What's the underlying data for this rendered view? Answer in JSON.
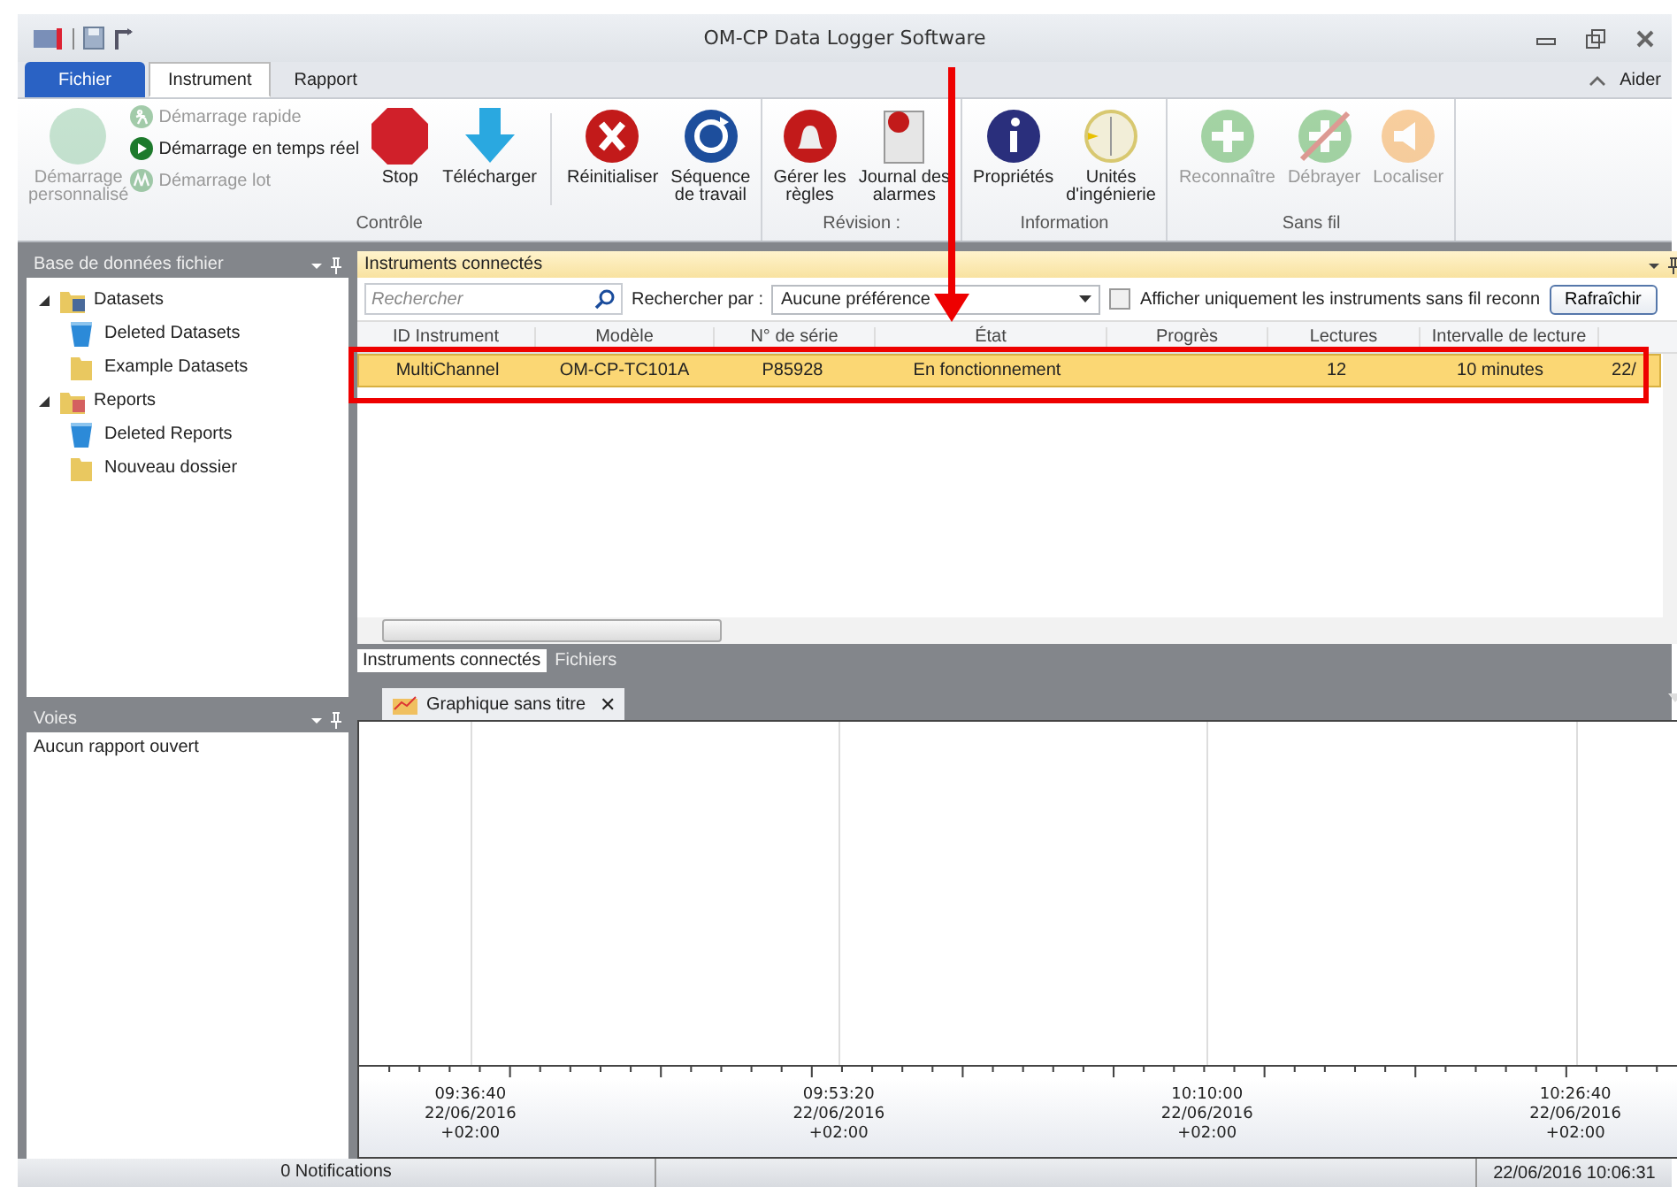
{
  "window": {
    "title": "OM-CP Data Logger Software"
  },
  "ribbon_tabs": [
    {
      "label": "Fichier",
      "kind": "file",
      "selected": false
    },
    {
      "label": "Instrument",
      "kind": "tab",
      "selected": true
    },
    {
      "label": "Rapport",
      "kind": "tab",
      "selected": false
    }
  ],
  "help": "Aider",
  "ribbon_groups": [
    {
      "label": "Contrôle",
      "items": [
        {
          "kind": "large",
          "label": "Démarrage\npersonnalisé",
          "disabled": true
        },
        {
          "kind": "stack",
          "items": [
            {
              "label": "Démarrage rapide",
              "disabled": true
            },
            {
              "label": "Démarrage en temps réel",
              "disabled": false
            },
            {
              "label": "Démarrage lot",
              "disabled": true
            }
          ]
        },
        {
          "kind": "large",
          "label": "Stop",
          "disabled": false
        },
        {
          "kind": "large",
          "label": "Télécharger",
          "disabled": false
        },
        {
          "kind": "separator"
        },
        {
          "kind": "large",
          "label": "Réinitialiser",
          "disabled": false
        },
        {
          "kind": "large",
          "label": "Séquence\nde travail",
          "disabled": false
        }
      ]
    },
    {
      "label": "Révision :",
      "items": [
        {
          "kind": "large",
          "label": "Gérer les\nrègles",
          "disabled": false
        },
        {
          "kind": "large",
          "label": "Journal des\nalarmes",
          "disabled": false
        }
      ]
    },
    {
      "label": "Information",
      "items": [
        {
          "kind": "large",
          "label": "Propriétés",
          "disabled": false
        },
        {
          "kind": "large",
          "label": "Unités\nd'ingénierie",
          "disabled": false
        }
      ]
    },
    {
      "label": "Sans fil",
      "items": [
        {
          "kind": "large",
          "label": "Reconnaître",
          "disabled": true
        },
        {
          "kind": "large",
          "label": "Débrayer",
          "disabled": true
        },
        {
          "kind": "large",
          "label": "Localiser",
          "disabled": true
        }
      ]
    }
  ],
  "file_panel": {
    "title": "Base de données fichier",
    "tree": [
      {
        "label": "Datasets",
        "kind": "folder",
        "expanded": true,
        "children": [
          {
            "label": "Deleted Datasets",
            "kind": "trash"
          },
          {
            "label": "Example Datasets",
            "kind": "folder"
          }
        ]
      },
      {
        "label": "Reports",
        "kind": "folder",
        "expanded": true,
        "children": [
          {
            "label": "Deleted Reports",
            "kind": "trash"
          },
          {
            "label": "Nouveau dossier",
            "kind": "folder"
          }
        ]
      }
    ]
  },
  "channels_panel": {
    "title": "Voies",
    "message": "Aucun rapport ouvert"
  },
  "instruments_panel": {
    "title": "Instruments connectés",
    "search": {
      "placeholder": "Rechercher"
    },
    "search_by_label": "Rechercher par :",
    "search_by_value": "Aucune préférence",
    "wireless_only": {
      "label": "Afficher uniquement les instruments sans fil reconn",
      "checked": false
    },
    "refresh": "Rafraîchir",
    "columns": [
      "ID Instrument",
      "Modèle",
      "N° de série",
      "État",
      "Progrès",
      "Lectures",
      "Intervalle de lecture"
    ],
    "rows": [
      {
        "cells": [
          "MultiChannel",
          "OM-CP-TC101A",
          "P85928",
          "En fonctionnement",
          "",
          "12",
          "10 minutes",
          "22/"
        ],
        "selected": true
      }
    ],
    "bottom_tabs": [
      {
        "label": "Instruments connectés",
        "selected": true
      },
      {
        "label": "Fichiers",
        "selected": false
      }
    ]
  },
  "chart_tab": {
    "label": "Graphique sans titre",
    "close": "✕"
  },
  "chart_axis": [
    {
      "time": "09:36:40",
      "date": "22/06/2016",
      "offset": "+02:00"
    },
    {
      "time": "09:53:20",
      "date": "22/06/2016",
      "offset": "+02:00"
    },
    {
      "time": "10:10:00",
      "date": "22/06/2016",
      "offset": "+02:00"
    },
    {
      "time": "10:26:40",
      "date": "22/06/2016",
      "offset": "+02:00"
    }
  ],
  "status_bar": {
    "notifications": "0 Notifications",
    "datetime": "22/06/2016 10:06:31"
  }
}
